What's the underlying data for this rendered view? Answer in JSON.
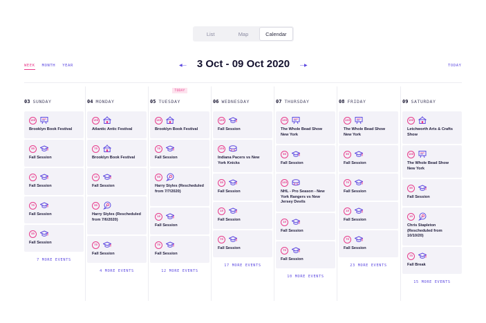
{
  "views": [
    {
      "label": "List",
      "active": false
    },
    {
      "label": "Map",
      "active": false
    },
    {
      "label": "Calendar",
      "active": true
    }
  ],
  "ranges": [
    {
      "label": "WEEK",
      "active": true
    },
    {
      "label": "MONTH",
      "active": false
    },
    {
      "label": "YEAR",
      "active": false
    }
  ],
  "nav": {
    "prev_icon": "arrow-left-icon",
    "next_icon": "arrow-right-icon",
    "title": "3 Oct - 09 Oct 2020",
    "today_label": "TODAY"
  },
  "today_badge": "TODAY",
  "colors": {
    "accent": "#5a46e0",
    "pink": "#e83a8a",
    "card": "#f3f2f8"
  },
  "days": [
    {
      "num": "03",
      "name": "SUNDAY",
      "events": [
        {
          "badge": "155",
          "icon": "easel-icon",
          "title": "Brooklyn Book Festival",
          "lines": 1
        },
        {
          "badge": "55",
          "icon": "graduation-cap-icon",
          "title": "Fall Session",
          "lines": 1
        },
        {
          "badge": "15",
          "icon": "graduation-cap-icon",
          "title": "Fall Session",
          "lines": 1
        },
        {
          "badge": "75",
          "icon": "graduation-cap-icon",
          "title": "Fall Session",
          "lines": 1
        },
        {
          "badge": "55",
          "icon": "graduation-cap-icon",
          "title": "Fall Session",
          "lines": 1
        }
      ],
      "more": "7 MORE EVENTS"
    },
    {
      "num": "04",
      "name": "MONDAY",
      "events": [
        {
          "badge": "155",
          "icon": "tent-icon",
          "title": "Atlantic Antic Festival",
          "lines": 1
        },
        {
          "badge": "75",
          "icon": "tent-icon",
          "title": "Brooklyn Book Festival",
          "lines": 1
        },
        {
          "badge": "15",
          "icon": "graduation-cap-icon",
          "title": "Fall Session",
          "lines": 1
        },
        {
          "badge": "55",
          "icon": "mic-bubble-icon",
          "title": "Harry Styles (Rescheduled from 7/6/2020)",
          "lines": 3
        },
        {
          "badge": "75",
          "icon": "graduation-cap-icon",
          "title": "Fall Session",
          "lines": 1
        }
      ],
      "more": "4 MORE EVENTS"
    },
    {
      "num": "05",
      "name": "TUESDAY",
      "today": true,
      "events": [
        {
          "badge": "155",
          "icon": "tent-icon",
          "title": "Brooklyn Book Festival",
          "lines": 1
        },
        {
          "badge": "75",
          "icon": "graduation-cap-icon",
          "title": "Fall Session",
          "lines": 1
        },
        {
          "badge": "55",
          "icon": "mic-bubble-icon",
          "title": "Harry Styles (Rescheduled from 7/7/2020)",
          "lines": 3
        },
        {
          "badge": "15",
          "icon": "graduation-cap-icon",
          "title": "Fall Session",
          "lines": 1
        },
        {
          "badge": "75",
          "icon": "graduation-cap-icon",
          "title": "Fall Session",
          "lines": 1
        }
      ],
      "more": "12 MORE EVENTS"
    },
    {
      "num": "06",
      "name": "WEDNESDAY",
      "events": [
        {
          "badge": "155",
          "icon": "graduation-cap-icon",
          "title": "Fall Session",
          "lines": 1
        },
        {
          "badge": "155",
          "icon": "stadium-icon",
          "title": "Indiana Pacers vs New York Knicks",
          "lines": 2
        },
        {
          "badge": "55",
          "icon": "graduation-cap-icon",
          "title": "Fall Session",
          "lines": 1
        },
        {
          "badge": "15",
          "icon": "graduation-cap-icon",
          "title": "Fall Session",
          "lines": 1
        },
        {
          "badge": "75",
          "icon": "graduation-cap-icon",
          "title": "Fall Session",
          "lines": 1
        }
      ],
      "more": "17 MORE EVENTS"
    },
    {
      "num": "07",
      "name": "THURSDAY",
      "events": [
        {
          "badge": "155",
          "icon": "easel-icon",
          "title": "The Whole Bead Show New York",
          "lines": 2
        },
        {
          "badge": "55",
          "icon": "graduation-cap-icon",
          "title": "Fall Session",
          "lines": 1
        },
        {
          "badge": "155",
          "icon": "stadium-icon",
          "title": "NHL - Pro Season - New York Rangers vs New Jersey Devils",
          "lines": 3
        },
        {
          "badge": "15",
          "icon": "graduation-cap-icon",
          "title": "Fall Session",
          "lines": 1
        },
        {
          "badge": "75",
          "icon": "graduation-cap-icon",
          "title": "Fall Session",
          "lines": 1
        }
      ],
      "more": "10 MORE EVENTS"
    },
    {
      "num": "08",
      "name": "FRIDAY",
      "events": [
        {
          "badge": "155",
          "icon": "easel-icon",
          "title": "The Whole Bead Show New York",
          "lines": 2
        },
        {
          "badge": "55",
          "icon": "graduation-cap-icon",
          "title": "Fall Session",
          "lines": 1
        },
        {
          "badge": "75",
          "icon": "graduation-cap-icon",
          "title": "Fall Session",
          "lines": 1
        },
        {
          "badge": "15",
          "icon": "graduation-cap-icon",
          "title": "Fall Session",
          "lines": 1
        },
        {
          "badge": "75",
          "icon": "graduation-cap-icon",
          "title": "Fall Session",
          "lines": 1
        }
      ],
      "more": "23 MORE EVENTS"
    },
    {
      "num": "09",
      "name": "SATURDAY",
      "events": [
        {
          "badge": "155",
          "icon": "tent-icon",
          "title": "Letchworth Arts & Crafts Show",
          "lines": 2
        },
        {
          "badge": "155",
          "icon": "easel-icon",
          "title": "The Whole Bead Show New York",
          "lines": 2
        },
        {
          "badge": "55",
          "icon": "graduation-cap-icon",
          "title": "Fall Session",
          "lines": 1
        },
        {
          "badge": "15",
          "icon": "mic-bubble-icon",
          "title": "Chris Stapleton (Rescheduled from 10/10/20)",
          "lines": 3
        },
        {
          "badge": "75",
          "icon": "graduation-cap-icon",
          "title": "Fall Break",
          "lines": 1
        }
      ],
      "more": "15 MORE EVENTS"
    }
  ]
}
